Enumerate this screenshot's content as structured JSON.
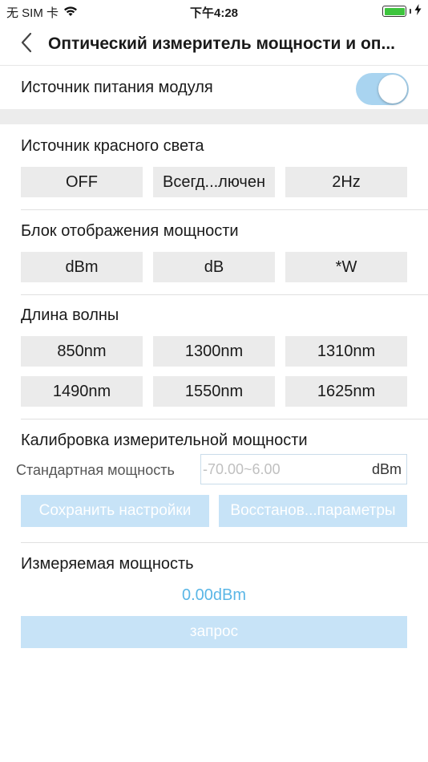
{
  "status_bar": {
    "carrier": "无 SIM 卡",
    "time": "下午4:28",
    "icons": [
      "wifi-icon",
      "battery-icon",
      "charging-icon"
    ],
    "battery_color": "#3dc43d"
  },
  "nav": {
    "back_icon": "chevron-left-icon",
    "title": "Оптический измеритель мощности и оп..."
  },
  "module_power": {
    "label": "Источник питания модуля",
    "toggle_on": true,
    "toggle_color": "#a9d4f0"
  },
  "red_light": {
    "label": "Источник красного света",
    "options": [
      "OFF",
      "Всегд...лючен",
      "2Hz"
    ]
  },
  "power_unit": {
    "label": "Блок отображения мощности",
    "options": [
      "dBm",
      "dB",
      "*W"
    ]
  },
  "wavelength": {
    "label": "Длина волны",
    "options": [
      "850nm",
      "1300nm",
      "1310nm",
      "1490nm",
      "1550nm",
      "1625nm"
    ]
  },
  "calibration": {
    "label": "Калибровка измерительной мощности",
    "field_label": "Стандартная мощность",
    "value": "",
    "placeholder": "-70.00~6.00",
    "unit": "dBm",
    "save_label": "Сохранить настройки",
    "restore_label": "Восстанов...параметры"
  },
  "measured": {
    "label": "Измеряемая мощность",
    "value": "0.00dBm",
    "value_color": "#5ab6e6",
    "query_label": "запрос"
  },
  "colors": {
    "light_button": "#c7e3f7",
    "option_button": "#ebebeb"
  }
}
